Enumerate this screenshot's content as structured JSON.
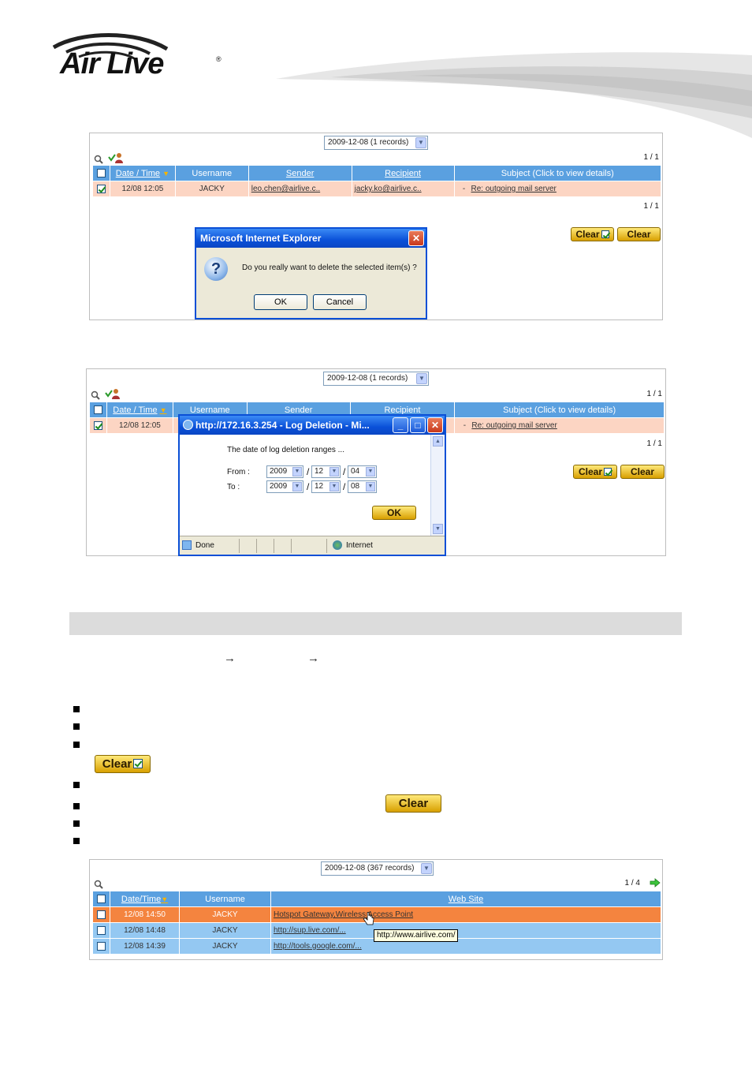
{
  "brand": {
    "name": "Air Live",
    "registered": "®"
  },
  "panel1": {
    "date_select": "2009-12-08 (1 records)",
    "pager_top": "1 / 1",
    "pager_bottom": "1 / 1",
    "headers": [
      "Date / Time",
      "Username",
      "Sender",
      "Recipient",
      "Subject (Click to view details)"
    ],
    "row": {
      "datetime": "12/08 12:05",
      "username": "JACKY",
      "sender": "leo.chen@airlive.c..",
      "recipient": "jacky.ko@airlive.c..",
      "dash": "-",
      "subject": "Re: outgoing mail server"
    },
    "clear_checked_label": "Clear",
    "clear_label": "Clear",
    "dialog": {
      "title": "Microsoft Internet Explorer",
      "message": "Do you really want to delete the selected item(s) ?",
      "ok": "OK",
      "cancel": "Cancel"
    }
  },
  "panel2": {
    "date_select": "2009-12-08 (1 records)",
    "pager_top": "1 / 1",
    "pager_bottom": "1 / 1",
    "headers": [
      "Date / Time",
      "Username",
      "Sender",
      "Recipient",
      "Subject (Click to view details)"
    ],
    "row": {
      "datetime": "12/08 12:05",
      "dash": "-",
      "subject": "Re: outgoing mail server"
    },
    "clear_checked_label": "Clear",
    "clear_label": "Clear",
    "popup": {
      "title": "http://172.16.3.254 - Log Deletion - Mi...",
      "heading": "The date of log deletion ranges ...",
      "from_label": "From :",
      "to_label": "To :",
      "from": {
        "year": "2009",
        "month": "12",
        "day": "04"
      },
      "to": {
        "year": "2009",
        "month": "12",
        "day": "08"
      },
      "sep": "/",
      "ok": "OK",
      "status_done": "Done",
      "status_zone": "Internet"
    }
  },
  "body": {
    "arrow1": "→",
    "arrow2": "→",
    "inline_clear_checked": "Clear",
    "inline_clear": "Clear"
  },
  "panel3": {
    "date_select": "2009-12-08 (367 records)",
    "pager": "1 / 4",
    "headers": [
      "Date/Time",
      "Username",
      "Web Site"
    ],
    "rows": [
      {
        "datetime": "12/08 14:50",
        "username": "JACKY",
        "site": "Hotspot Gateway,Wireless Access Point"
      },
      {
        "datetime": "12/08 14:48",
        "username": "JACKY",
        "site": "http://sup.live.com/..."
      },
      {
        "datetime": "12/08 14:39",
        "username": "JACKY",
        "site": "http://tools.google.com/..."
      }
    ],
    "tooltip": "http://www.airlive.com/"
  },
  "colors": {
    "header_blue": "#5aa0e0",
    "row_pink": "#fcd5c3",
    "row_orange": "#f4843f",
    "row_blue": "#94c8f2"
  }
}
